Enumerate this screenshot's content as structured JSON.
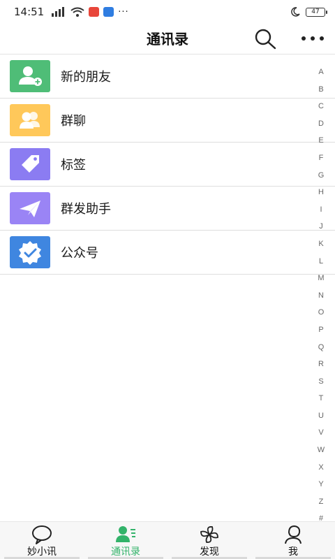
{
  "status_bar": {
    "time": "14:51",
    "dots": "···",
    "battery": "47"
  },
  "header": {
    "title": "通讯录"
  },
  "rows": [
    {
      "label": "新的朋友",
      "icon": "add-friend-icon",
      "color": "#4fbd77"
    },
    {
      "label": "群聊",
      "icon": "group-chat-icon",
      "color": "#ffc85a"
    },
    {
      "label": "标签",
      "icon": "tag-icon",
      "color": "#8b7cf2"
    },
    {
      "label": "群发助手",
      "icon": "paper-plane-icon",
      "color": "#9a84f5"
    },
    {
      "label": "公众号",
      "icon": "verified-badge-icon",
      "color": "#3f86e0"
    }
  ],
  "index": [
    "A",
    "B",
    "C",
    "D",
    "E",
    "F",
    "G",
    "H",
    "I",
    "J",
    "K",
    "L",
    "M",
    "N",
    "O",
    "P",
    "Q",
    "R",
    "S",
    "T",
    "U",
    "V",
    "W",
    "X",
    "Y",
    "Z",
    "#"
  ],
  "nav": [
    {
      "label": "妙小讯",
      "icon": "chat-bubble-icon"
    },
    {
      "label": "通讯录",
      "icon": "contacts-icon",
      "active": true
    },
    {
      "label": "发现",
      "icon": "pinwheel-icon"
    },
    {
      "label": "我",
      "icon": "person-icon"
    }
  ],
  "colors": {
    "accent": "#33b36a"
  }
}
